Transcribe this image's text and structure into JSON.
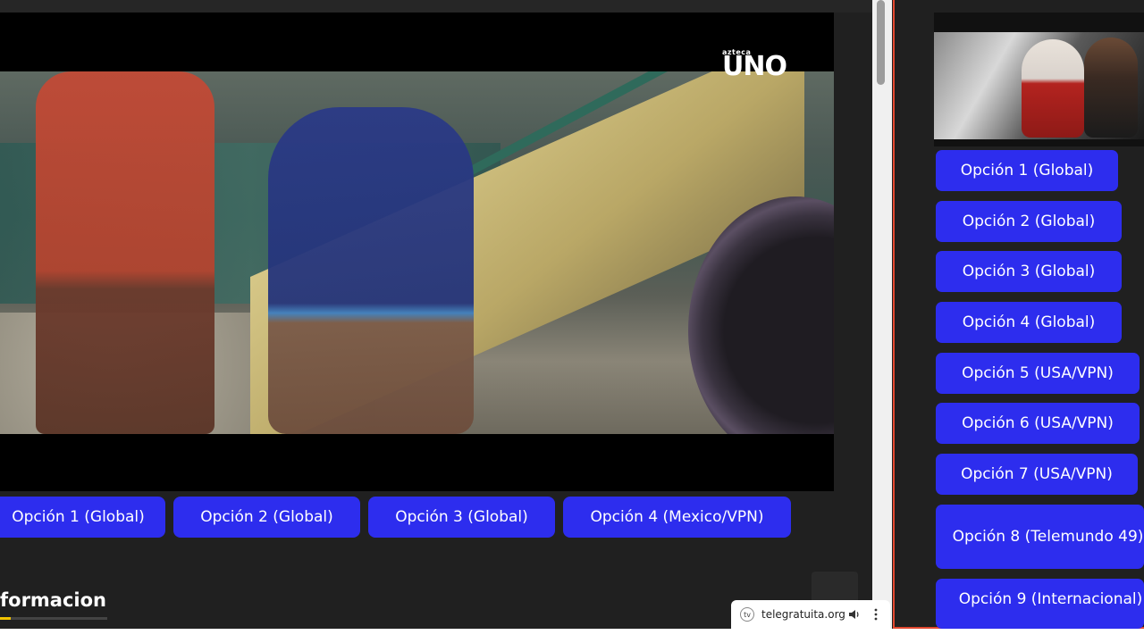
{
  "player": {
    "channel_logo_small": "azteca",
    "channel_logo_big": "UNO"
  },
  "tabs": [
    {
      "label": "Opción 1 (Global)"
    },
    {
      "label": "Opción 2 (Global)"
    },
    {
      "label": "Opción 3 (Global)"
    },
    {
      "label": "Opción 4 (Mexico/VPN)"
    }
  ],
  "section": {
    "title": "formacion"
  },
  "sidebar": {
    "options": [
      {
        "label": "Opción 1 (Global)"
      },
      {
        "label": "Opción 2 (Global)"
      },
      {
        "label": "Opción 3 (Global)"
      },
      {
        "label": "Opción 4 (Global)"
      },
      {
        "label": "Opción 5 (USA/VPN)"
      },
      {
        "label": "Opción 6 (USA/VPN)"
      },
      {
        "label": "Opción 7 (USA/VPN)"
      },
      {
        "label": "Opción 8 (Telemundo 49)"
      },
      {
        "label": "Opción 9 (Internacional)"
      }
    ]
  },
  "mini_player": {
    "site": "telegratuita.org",
    "favicon": "tv-icon",
    "sound_icon": "speaker-icon",
    "menu_icon": "more-vert-icon"
  },
  "colors": {
    "button": "#2d2dee",
    "accent": "#f2c400",
    "frame": "#e2472f"
  }
}
